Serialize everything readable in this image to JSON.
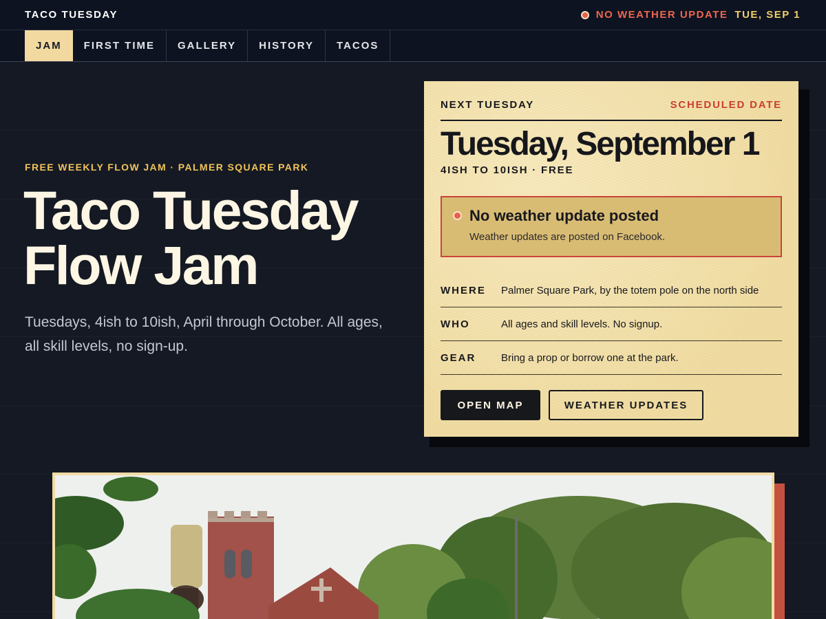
{
  "topbar": {
    "brand": "TACO TUESDAY",
    "status_alert": "NO WEATHER UPDATE",
    "status_date": "TUE, SEP 1",
    "status_dot_icon": "status-dot-icon"
  },
  "nav": {
    "items": [
      {
        "label": "JAM",
        "active": true
      },
      {
        "label": "FIRST TIME",
        "active": false
      },
      {
        "label": "GALLERY",
        "active": false
      },
      {
        "label": "HISTORY",
        "active": false
      },
      {
        "label": "TACOS",
        "active": false
      }
    ]
  },
  "hero": {
    "eyebrow": "FREE WEEKLY FLOW JAM · PALMER SQUARE PARK",
    "title_line1": "Taco Tuesday",
    "title_line2": "Flow Jam",
    "subtitle": "Tuesdays, 4ish to 10ish, April through October. All ages, all skill levels, no sign-up."
  },
  "card": {
    "label": "NEXT TUESDAY",
    "tag": "SCHEDULED DATE",
    "date": "Tuesday, September 1",
    "time": "4ISH TO 10ISH · FREE",
    "weather": {
      "title": "No weather update posted",
      "text": "Weather updates are posted on Facebook."
    },
    "rows": [
      {
        "label": "WHERE",
        "value": "Palmer Square Park, by the totem pole on the north side"
      },
      {
        "label": "WHO",
        "value": "All ages and skill levels. No signup."
      },
      {
        "label": "GEAR",
        "value": "Bring a prop or borrow one at the park."
      }
    ],
    "buttons": {
      "primary": "OPEN MAP",
      "secondary": "WEATHER UPDATES"
    }
  },
  "colors": {
    "background": "#141923",
    "accent_yellow": "#f2c35a",
    "alert_red": "#ee6650",
    "card_paper": "#f2e0a8",
    "photo_accent": "#c4503f"
  }
}
